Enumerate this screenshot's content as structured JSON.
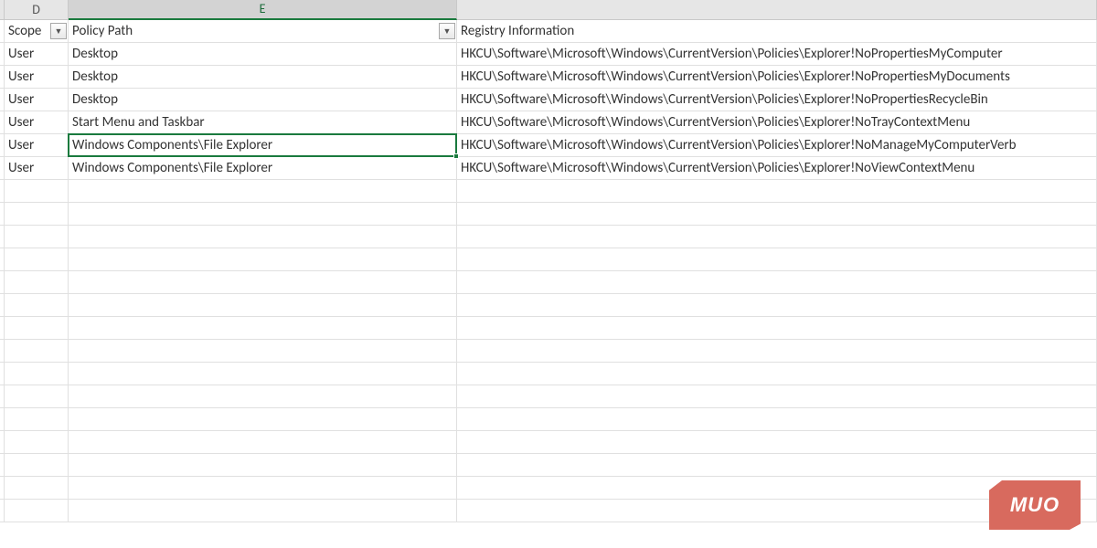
{
  "columns": {
    "D": {
      "letter": "D"
    },
    "E": {
      "letter": "E"
    },
    "F": {
      "letter": ""
    }
  },
  "headers": {
    "scope": "Scope",
    "policy_path": "Policy Path",
    "registry_info": "Registry Information"
  },
  "rows": [
    {
      "scope": "User",
      "policy_path": "Desktop",
      "registry_info": "HKCU\\Software\\Microsoft\\Windows\\CurrentVersion\\Policies\\Explorer!NoPropertiesMyComputer"
    },
    {
      "scope": "User",
      "policy_path": "Desktop",
      "registry_info": "HKCU\\Software\\Microsoft\\Windows\\CurrentVersion\\Policies\\Explorer!NoPropertiesMyDocuments"
    },
    {
      "scope": "User",
      "policy_path": "Desktop",
      "registry_info": "HKCU\\Software\\Microsoft\\Windows\\CurrentVersion\\Policies\\Explorer!NoPropertiesRecycleBin"
    },
    {
      "scope": "User",
      "policy_path": "Start Menu and Taskbar",
      "registry_info": "HKCU\\Software\\Microsoft\\Windows\\CurrentVersion\\Policies\\Explorer!NoTrayContextMenu"
    },
    {
      "scope": "User",
      "policy_path": "Windows Components\\File Explorer",
      "registry_info": "HKCU\\Software\\Microsoft\\Windows\\CurrentVersion\\Policies\\Explorer!NoManageMyComputerVerb"
    },
    {
      "scope": "User",
      "policy_path": "Windows Components\\File Explorer",
      "registry_info": "HKCU\\Software\\Microsoft\\Windows\\CurrentVersion\\Policies\\Explorer!NoViewContextMenu"
    }
  ],
  "empty_row_count": 15,
  "active_cell": {
    "col": "E",
    "row_index": 5
  },
  "watermark": {
    "text": "MUO"
  },
  "icons": {
    "filter_glyph": "▼"
  }
}
